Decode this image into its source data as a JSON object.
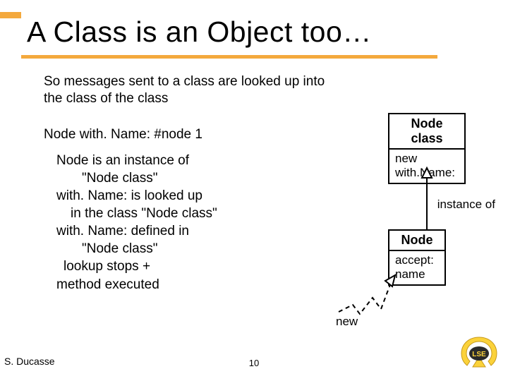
{
  "slide": {
    "title": "A Class is an Object too…",
    "intro": "So messages sent to a class are looked up into the class of the class",
    "code": "Node with. Name: #node 1",
    "details": [
      "Node is an instance of",
      "\"Node class\"",
      "with. Name: is looked up",
      "in the class \"Node class\"",
      "with. Name: defined in",
      "\"Node class\"",
      "lookup stops +",
      "method executed"
    ]
  },
  "diagram": {
    "nodeclass": {
      "title": "Node class",
      "rows": [
        "new",
        "with.Name:"
      ]
    },
    "node": {
      "title": "Node",
      "rows": [
        "accept:",
        "name"
      ]
    },
    "instance_label": "instance of",
    "new_label": "new"
  },
  "footer": {
    "author": "S. Ducasse",
    "page": "10"
  },
  "logo": {
    "text": "LSE"
  }
}
